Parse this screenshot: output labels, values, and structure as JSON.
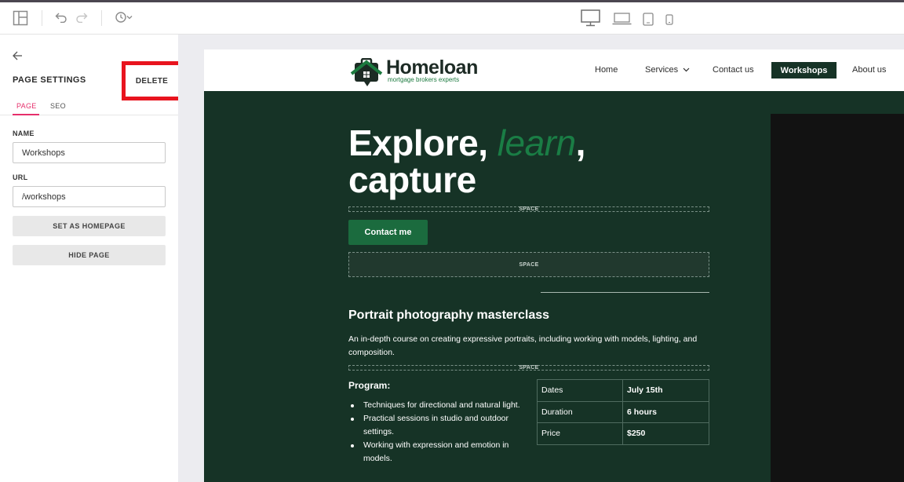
{
  "toolbar": {
    "icons": [
      "layout-icon",
      "undo-icon",
      "redo-icon",
      "history-icon",
      "desktop-icon",
      "laptop-icon",
      "tablet-icon",
      "mobile-icon"
    ]
  },
  "sidebar": {
    "title": "PAGE SETTINGS",
    "delete_label": "DELETE",
    "tabs": [
      {
        "label": "PAGE",
        "active": true
      },
      {
        "label": "SEO",
        "active": false
      }
    ],
    "name_label": "NAME",
    "name_value": "Workshops",
    "url_label": "URL",
    "url_value": "/workshops",
    "set_homepage_label": "SET AS HOMEPAGE",
    "hide_page_label": "HIDE PAGE"
  },
  "site": {
    "logo_main": "Homeloan",
    "logo_sub": "mortgage brokers   experts",
    "nav": [
      "Home",
      "Services",
      "Contact us",
      "Workshops",
      "About us"
    ],
    "nav_active": "Workshops",
    "hero_line1_a": "Explore, ",
    "hero_line1_em": "learn",
    "hero_line1_b": ",",
    "hero_line2": "capture",
    "space_label": "SPACE",
    "cta_label": "Contact me",
    "section_title": "Portrait photography masterclass",
    "description": "An in-depth course on creating expressive portraits, including working with models, lighting, and composition.",
    "program_title": "Program:",
    "program_items": [
      "Techniques for directional and natural light.",
      "Practical sessions in studio and outdoor settings.",
      "Working with expression and emotion in models."
    ],
    "info_rows": [
      {
        "label": "Dates",
        "value": "July 15th"
      },
      {
        "label": "Duration",
        "value": "6 hours"
      },
      {
        "label": "Price",
        "value": "$250"
      }
    ]
  },
  "colors": {
    "site_bg": "#163326",
    "accent_green": "#1b6b3e",
    "tab_active": "#e62f6b",
    "highlight_red": "#e8141e"
  }
}
